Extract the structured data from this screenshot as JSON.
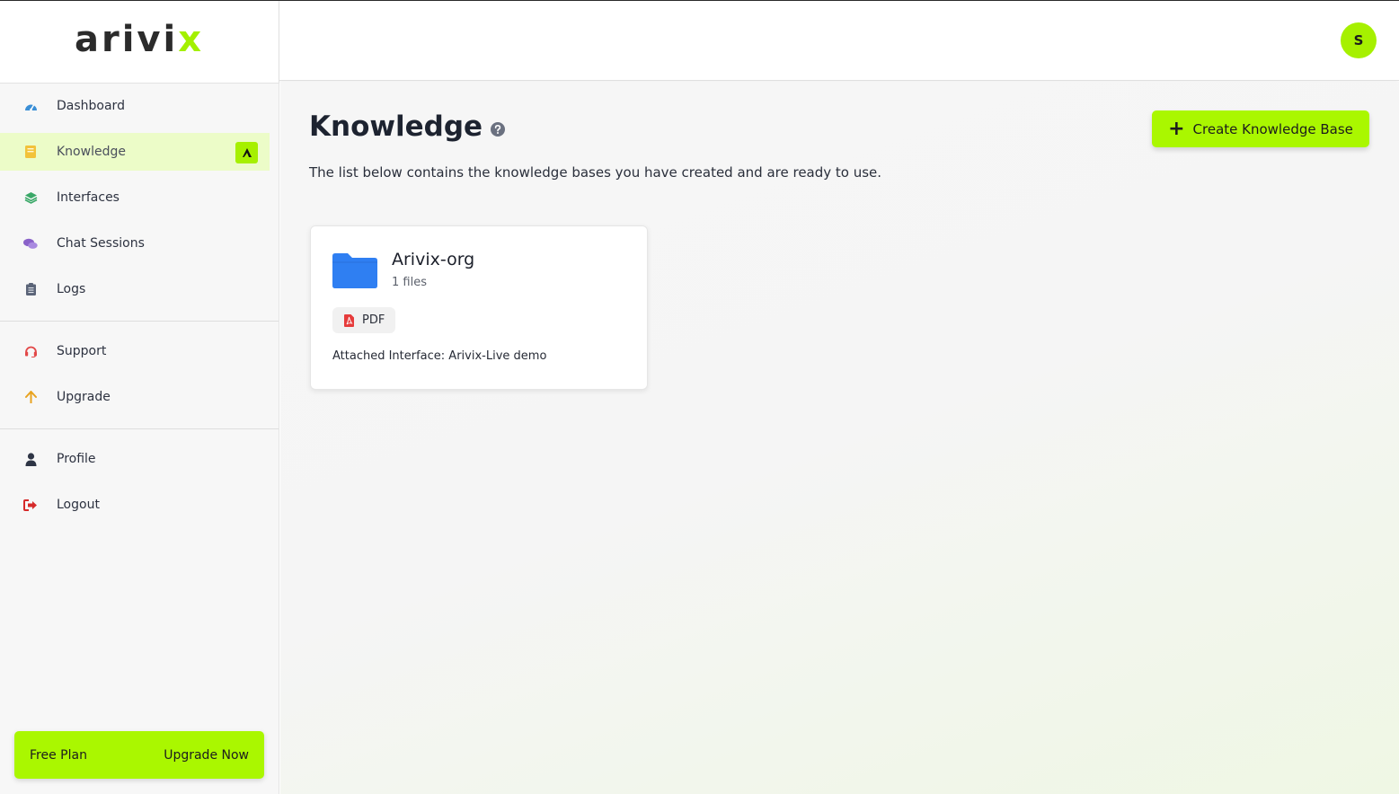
{
  "app": {
    "logo_main": "arivi",
    "logo_accent": "x",
    "brand_color": "#a6f000"
  },
  "sidebar": {
    "items_main": [
      {
        "label": "Dashboard",
        "icon": "dashboard-icon"
      },
      {
        "label": "Knowledge",
        "icon": "book-icon",
        "active": true,
        "badge": "A"
      },
      {
        "label": "Interfaces",
        "icon": "layers-icon"
      },
      {
        "label": "Chat Sessions",
        "icon": "chat-icon"
      },
      {
        "label": "Logs",
        "icon": "clipboard-icon"
      }
    ],
    "items_help": [
      {
        "label": "Support",
        "icon": "headset-icon"
      },
      {
        "label": "Upgrade",
        "icon": "arrow-up-icon"
      }
    ],
    "items_account": [
      {
        "label": "Profile",
        "icon": "user-icon"
      },
      {
        "label": "Logout",
        "icon": "logout-icon"
      }
    ],
    "plan": {
      "name": "Free Plan",
      "cta": "Upgrade Now"
    }
  },
  "header": {
    "avatar_initial": "S"
  },
  "main": {
    "title": "Knowledge",
    "subtitle": "The list below contains the knowledge bases you have created and are ready to use.",
    "create_button": "Create Knowledge Base",
    "knowledge_bases": [
      {
        "name": "Arivix-org",
        "file_count": "1 files",
        "file_types": [
          "PDF"
        ],
        "attached": "Attached Interface: Arivix-Live demo"
      }
    ]
  }
}
